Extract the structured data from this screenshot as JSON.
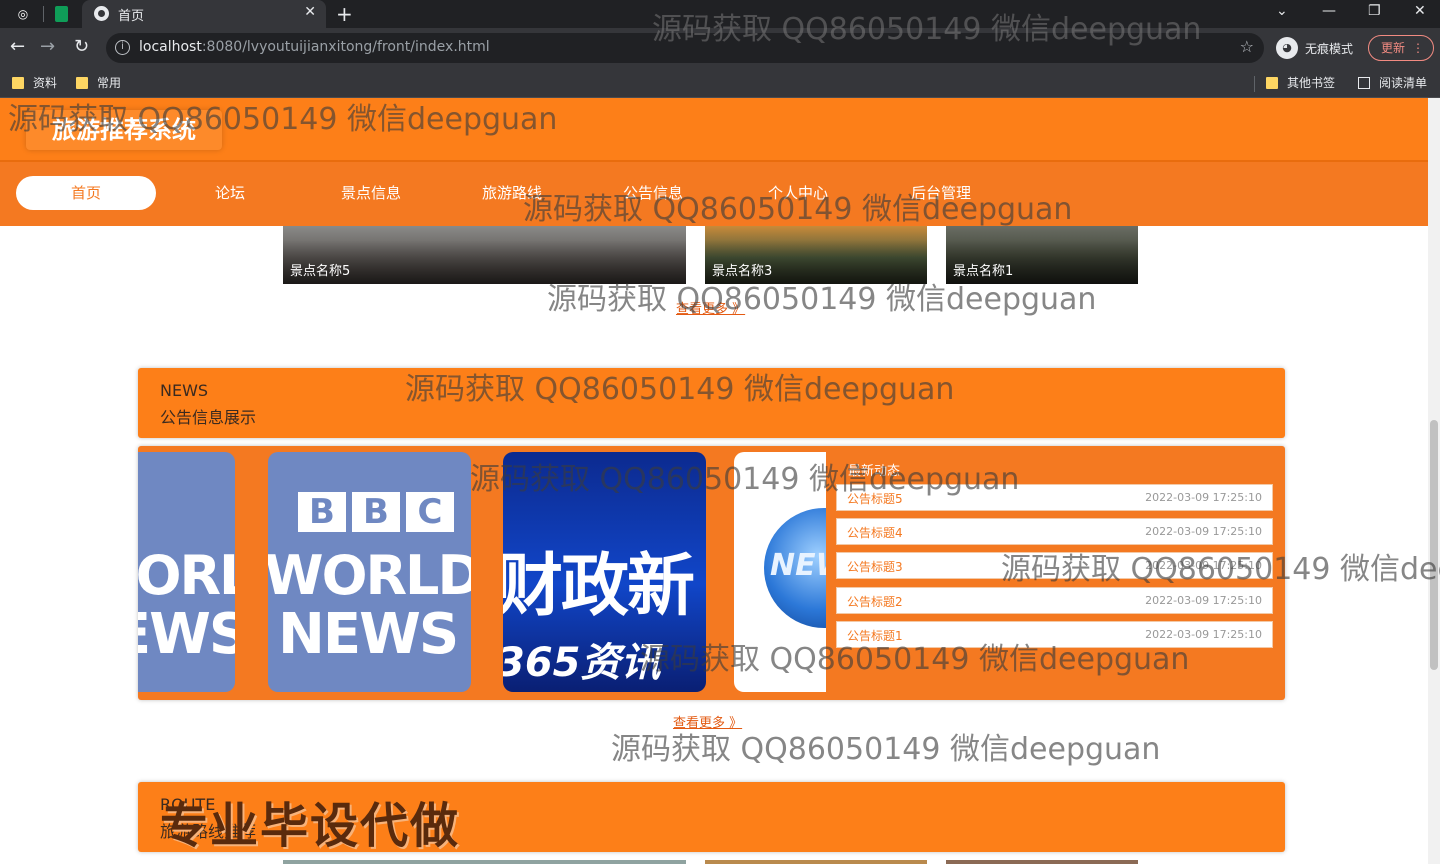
{
  "browser": {
    "tab_title": "首页",
    "url_host": "localhost",
    "url_rest": ":8080/lvyoutuijianxitong/front/index.html",
    "incognito_label": "无痕模式",
    "update_label": "更新",
    "bookmarks": [
      "资料",
      "常用"
    ],
    "bookmarks_right": [
      "其他书签",
      "阅读清单"
    ]
  },
  "site": {
    "brand": "旅游推荐系统",
    "nav": [
      "首页",
      "论坛",
      "景点信息",
      "旅游路线",
      "公告信息",
      "个人中心",
      "后台管理"
    ]
  },
  "scenic": {
    "cards": [
      "景点名称5",
      "景点名称3",
      "景点名称1"
    ],
    "more": "查看更多 》"
  },
  "news": {
    "en": "NEWS",
    "zh": "公告信息展示",
    "list_label": "最新动态",
    "items": [
      {
        "title": "公告标题5",
        "date": "2022-03-09 17:25:10"
      },
      {
        "title": "公告标题4",
        "date": "2022-03-09 17:25:10"
      },
      {
        "title": "公告标题3",
        "date": "2022-03-09 17:25:10"
      },
      {
        "title": "公告标题2",
        "date": "2022-03-09 17:25:10"
      },
      {
        "title": "公告标题1",
        "date": "2022-03-09 17:25:10"
      }
    ],
    "more": "查看更多 》",
    "slides": {
      "bbc_logo": [
        "B",
        "B",
        "C"
      ],
      "bbc_world": "WORLD",
      "bbc_news": "NEWS",
      "fin_title": "财政新",
      "fin_sub": "365资讯",
      "globe_text": "NEW"
    }
  },
  "route": {
    "en": "ROUTE",
    "zh": "旅游路线推荐",
    "promo": "专业毕设代做"
  },
  "watermark": "源码获取 QQ86050149 微信deepguan"
}
